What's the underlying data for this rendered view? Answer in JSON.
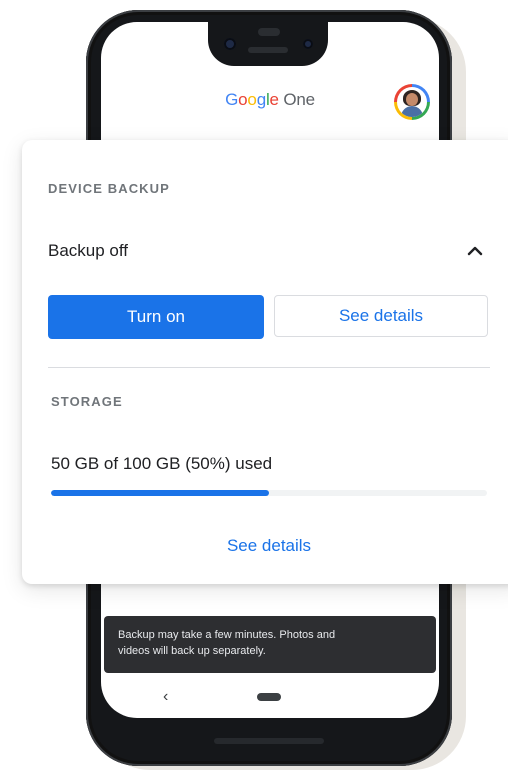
{
  "app": {
    "title_google": "Google",
    "title_one": "One",
    "avatar_icon": "user-avatar"
  },
  "device_backup": {
    "section_label": "DEVICE BACKUP",
    "status": "Backup off",
    "toggle_icon": "chevron-up-icon",
    "turn_on_label": "Turn on",
    "see_details_label": "See details"
  },
  "storage": {
    "section_label": "STORAGE",
    "usage_text": "50 GB of 100 GB (50%) used",
    "used_fraction": 0.5,
    "see_details_label": "See details"
  },
  "snackbar": {
    "line1": "Backup may take a few minutes. Photos and",
    "line2": "videos will back up separately."
  },
  "navbar": {
    "back_glyph": "‹"
  },
  "colors": {
    "accent": "#1a73e8",
    "text_primary": "#202124",
    "label_gray": "#70757a",
    "snackbar_bg": "#2d2e31"
  }
}
